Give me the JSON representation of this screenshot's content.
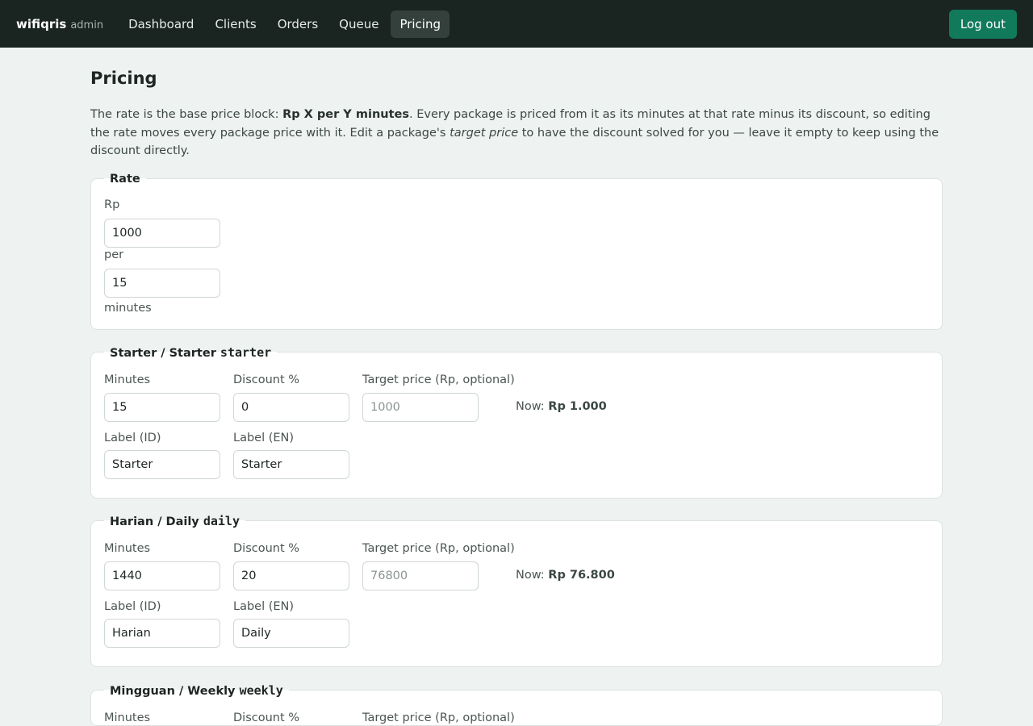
{
  "brand": {
    "name": "wifiqris",
    "sub": "admin"
  },
  "nav": {
    "items": [
      {
        "label": "Dashboard"
      },
      {
        "label": "Clients"
      },
      {
        "label": "Orders"
      },
      {
        "label": "Queue"
      },
      {
        "label": "Pricing",
        "active": true
      }
    ],
    "logout_label": "Log out"
  },
  "page": {
    "title": "Pricing",
    "intro_1": "The rate is the base price block: ",
    "intro_bold": "Rp X per Y minutes",
    "intro_2": ". Every package is priced from it as its minutes at that rate minus its discount, so editing the rate moves every package price with it. Edit a package's ",
    "intro_em": "target price",
    "intro_3": " to have the discount solved for you — leave it empty to keep using the discount directly."
  },
  "rate": {
    "legend": "Rate",
    "currency_label": "Rp",
    "amount_value": "1000",
    "per_label": "per",
    "minutes_value": "15",
    "minutes_label": "minutes"
  },
  "field_labels": {
    "minutes": "Minutes",
    "discount": "Discount %",
    "target": "Target price (Rp, optional)",
    "label_id": "Label (ID)",
    "label_en": "Label (EN)",
    "now": "Now: "
  },
  "packages": [
    {
      "legend": "Starter / Starter",
      "code": "starter",
      "minutes": "15",
      "discount": "0",
      "target_placeholder": "1000",
      "now_price": "Rp 1.000",
      "label_id": "Starter",
      "label_en": "Starter"
    },
    {
      "legend": "Harian / Daily",
      "code": "daily",
      "minutes": "1440",
      "discount": "20",
      "target_placeholder": "76800",
      "now_price": "Rp 76.800",
      "label_id": "Harian",
      "label_en": "Daily"
    },
    {
      "legend": "Mingguan / Weekly",
      "code": "weekly"
    }
  ]
}
